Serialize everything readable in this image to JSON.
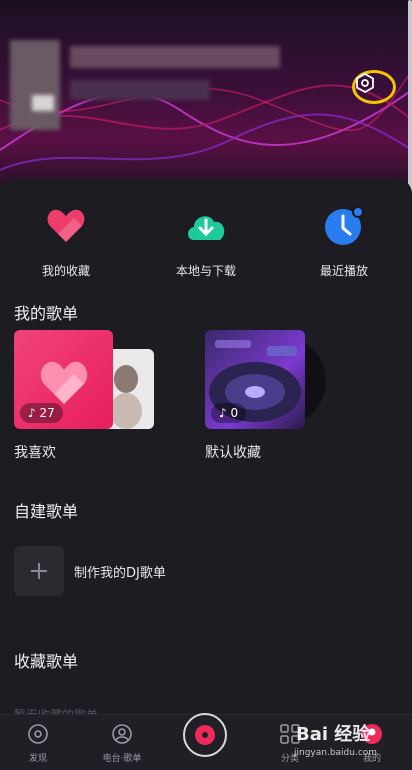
{
  "quick_actions": [
    {
      "label": "我的收藏",
      "icon": "heart-icon",
      "color": "#ee3d6b"
    },
    {
      "label": "本地与下载",
      "icon": "cloud-download-icon",
      "color": "#1ec99b"
    },
    {
      "label": "最近播放",
      "icon": "clock-icon",
      "color": "#2a7df0"
    }
  ],
  "my_playlists": {
    "title": "我的歌单",
    "items": [
      {
        "name": "我喜欢",
        "count": "27"
      },
      {
        "name": "默认收藏",
        "count": "0"
      }
    ]
  },
  "created_playlists": {
    "title": "自建歌单",
    "create_label": "制作我的DJ歌单"
  },
  "collected_playlists": {
    "title": "收藏歌单",
    "empty_text": "暂无收藏的歌单"
  },
  "bottom_nav": [
    {
      "label": "发现",
      "icon": "discover-icon"
    },
    {
      "label": "电台·歌单",
      "icon": "radio-icon"
    },
    {
      "label": "",
      "icon": "play-disc-icon"
    },
    {
      "label": "分类",
      "icon": "grid-icon"
    },
    {
      "label": "我的",
      "icon": "user-icon"
    }
  ],
  "watermark": {
    "main": "Bai 经验",
    "sub": "jingyan.baidu.com"
  },
  "colors": {
    "accent": "#ee2a5a",
    "highlight_ring": "#f2c400"
  }
}
